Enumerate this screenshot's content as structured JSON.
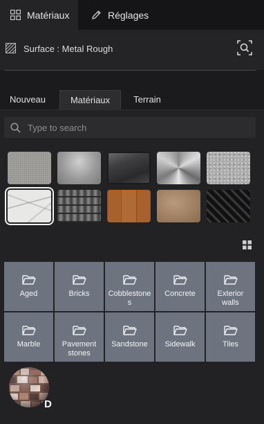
{
  "top_tabs": [
    {
      "label": "Matériaux",
      "icon": "grid-icon",
      "active": true
    },
    {
      "label": "Réglages",
      "icon": "pencil-icon",
      "active": false
    }
  ],
  "surface": {
    "label": "Surface : Metal Rough",
    "icon": "hatch-icon",
    "action_icon": "zoom-select-icon"
  },
  "tabs": [
    {
      "label": "Nouveau",
      "active": false
    },
    {
      "label": "Matériaux",
      "active": true
    },
    {
      "label": "Terrain",
      "active": false
    }
  ],
  "search": {
    "placeholder": "Type to search",
    "value": ""
  },
  "thumbnails": [
    {
      "name": "fabric-linen",
      "selected": false
    },
    {
      "name": "plastic-grey",
      "selected": false
    },
    {
      "name": "metal-dark",
      "selected": false
    },
    {
      "name": "metal-brushed-radial",
      "selected": false
    },
    {
      "name": "stucco-grey",
      "selected": false
    },
    {
      "name": "marble-white",
      "selected": true
    },
    {
      "name": "roof-tiles-dark",
      "selected": false
    },
    {
      "name": "wood-parquet",
      "selected": false
    },
    {
      "name": "leather-tan",
      "selected": false
    },
    {
      "name": "rubber-tread",
      "selected": false
    }
  ],
  "folders": [
    {
      "label": "Aged"
    },
    {
      "label": "Bricks"
    },
    {
      "label": "Cobblestones"
    },
    {
      "label": "Concrete"
    },
    {
      "label": "Exterior walls"
    },
    {
      "label": "Marble"
    },
    {
      "label": "Pavement stones"
    },
    {
      "label": "Sandstone"
    },
    {
      "label": "Sidewalk"
    },
    {
      "label": "Tiles"
    }
  ],
  "preview": {
    "letter": "D",
    "icon": "material-sphere"
  },
  "colors": {
    "accent_folder": "#6d7480",
    "panel": "#222225",
    "topbar": "#151517"
  }
}
